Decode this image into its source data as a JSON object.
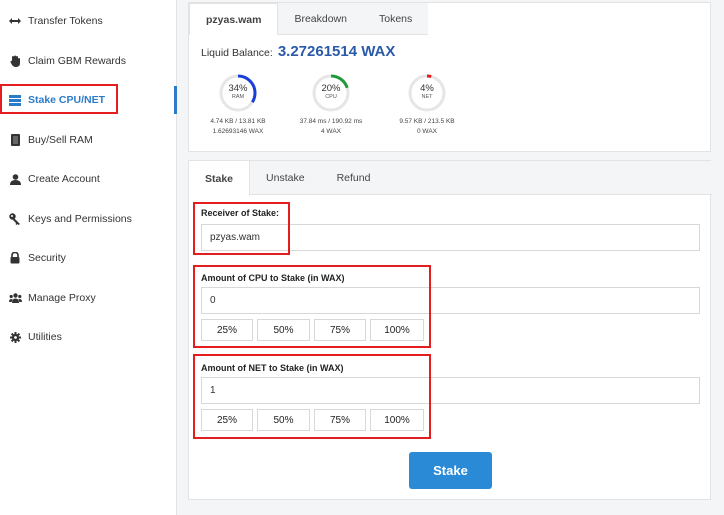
{
  "sidebar": {
    "items": [
      {
        "label": "Transfer Tokens",
        "icon": "transfer-arrows-icon"
      },
      {
        "label": "Claim GBM Rewards",
        "icon": "hand-icon"
      },
      {
        "label": "Stake CPU/NET",
        "icon": "stack-icon"
      },
      {
        "label": "Buy/Sell RAM",
        "icon": "ram-chip-icon"
      },
      {
        "label": "Create Account",
        "icon": "user-icon"
      },
      {
        "label": "Keys and Permissions",
        "icon": "key-icon"
      },
      {
        "label": "Security",
        "icon": "lock-icon"
      },
      {
        "label": "Manage Proxy",
        "icon": "users-icon"
      },
      {
        "label": "Utilities",
        "icon": "gear-icon"
      }
    ]
  },
  "account_tabs": [
    "pzyas.wam",
    "Breakdown",
    "Tokens"
  ],
  "balance": {
    "label": "Liquid Balance:",
    "value": "3.27261514 WAX"
  },
  "resources": [
    {
      "pct_label": "34%",
      "name": "RAM",
      "detail": "4.74 KB / 13.81 KB",
      "staked": "1.62693146 WAX",
      "fraction": 0.34,
      "color": "#1a3fd8"
    },
    {
      "pct_label": "20%",
      "name": "CPU",
      "detail": "37.84 ms / 190.92 ms",
      "staked": "4 WAX",
      "fraction": 0.2,
      "color": "#1f9a3a"
    },
    {
      "pct_label": "4%",
      "name": "NET",
      "detail": "9.57 KB / 213.5 KB",
      "staked": "0 WAX",
      "fraction": 0.04,
      "color": "#e41e1e"
    }
  ],
  "stake_tabs": [
    "Stake",
    "Unstake",
    "Refund"
  ],
  "form": {
    "receiver_label": "Receiver of Stake:",
    "receiver_value": "pzyas.wam",
    "cpu_label": "Amount of CPU to Stake (in WAX)",
    "cpu_value": "0",
    "net_label": "Amount of NET to Stake (in WAX)",
    "net_value": "1",
    "percent_buttons": [
      "25%",
      "50%",
      "75%",
      "100%"
    ],
    "submit_label": "Stake"
  },
  "colors": {
    "accent": "#2b7bc9",
    "highlight": "#e41e1e",
    "button": "#2b8ad6"
  }
}
